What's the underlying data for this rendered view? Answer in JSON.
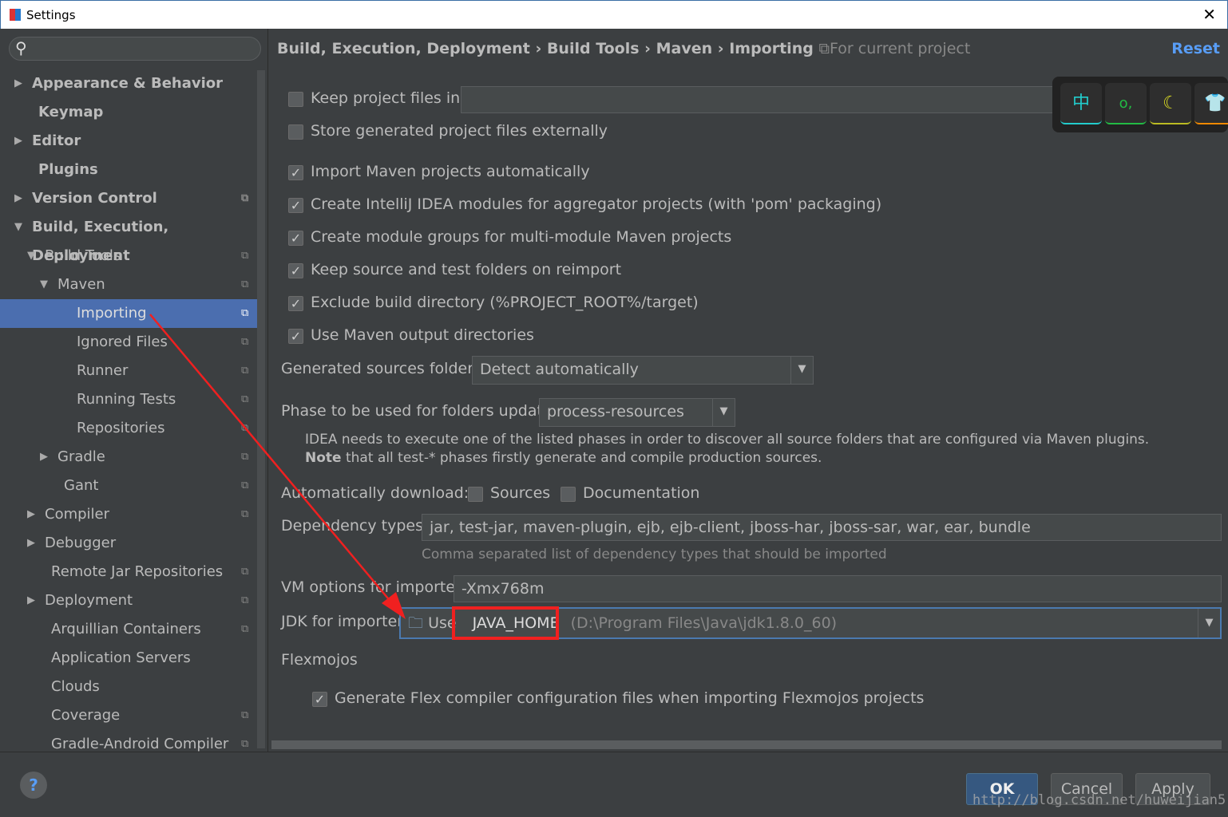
{
  "window": {
    "title": "Settings"
  },
  "sidebar": {
    "items": [
      {
        "label": "Appearance & Behavior",
        "level": 0,
        "arrow": "right",
        "bold": true,
        "proj": false
      },
      {
        "label": "Keymap",
        "level": 0,
        "arrow": "",
        "bold": true,
        "proj": false
      },
      {
        "label": "Editor",
        "level": 0,
        "arrow": "right",
        "bold": true,
        "proj": false
      },
      {
        "label": "Plugins",
        "level": 0,
        "arrow": "",
        "bold": true,
        "proj": false
      },
      {
        "label": "Version Control",
        "level": 0,
        "arrow": "right",
        "bold": true,
        "proj": true
      },
      {
        "label": "Build, Execution, Deployment",
        "level": 0,
        "arrow": "down",
        "bold": true,
        "proj": false
      },
      {
        "label": "Build Tools",
        "level": 1,
        "arrow": "down",
        "proj": true
      },
      {
        "label": "Maven",
        "level": 2,
        "arrow": "down",
        "proj": true
      },
      {
        "label": "Importing",
        "level": 3,
        "arrow": "",
        "proj": true,
        "selected": true
      },
      {
        "label": "Ignored Files",
        "level": 3,
        "arrow": "",
        "proj": true
      },
      {
        "label": "Runner",
        "level": 3,
        "arrow": "",
        "proj": true
      },
      {
        "label": "Running Tests",
        "level": 3,
        "arrow": "",
        "proj": true
      },
      {
        "label": "Repositories",
        "level": 3,
        "arrow": "",
        "proj": true
      },
      {
        "label": "Gradle",
        "level": 2,
        "arrow": "right",
        "proj": true
      },
      {
        "label": "Gant",
        "level": 2.5,
        "arrow": "",
        "proj": true
      },
      {
        "label": "Compiler",
        "level": 1,
        "arrow": "right",
        "proj": true
      },
      {
        "label": "Debugger",
        "level": 1,
        "arrow": "right",
        "proj": false
      },
      {
        "label": "Remote Jar Repositories",
        "level": 1.5,
        "arrow": "",
        "proj": true
      },
      {
        "label": "Deployment",
        "level": 1,
        "arrow": "right",
        "proj": true
      },
      {
        "label": "Arquillian Containers",
        "level": 1.5,
        "arrow": "",
        "proj": true
      },
      {
        "label": "Application Servers",
        "level": 1.5,
        "arrow": "",
        "proj": false
      },
      {
        "label": "Clouds",
        "level": 1.5,
        "arrow": "",
        "proj": false
      },
      {
        "label": "Coverage",
        "level": 1.5,
        "arrow": "",
        "proj": true
      },
      {
        "label": "Gradle-Android Compiler",
        "level": 1.5,
        "arrow": "",
        "proj": true
      }
    ]
  },
  "header": {
    "breadcrumb": "Build, Execution, Deployment › Build Tools › Maven › Importing",
    "for_project": "For current project",
    "reset": "Reset"
  },
  "options": {
    "keep_files": {
      "label": "Keep project files in:",
      "checked": false,
      "value": ""
    },
    "store_external": {
      "label": "Store generated project files externally",
      "checked": false
    },
    "checks": [
      {
        "label": "Import Maven projects automatically",
        "checked": true
      },
      {
        "label": "Create IntelliJ IDEA modules for aggregator projects (with 'pom' packaging)",
        "checked": true
      },
      {
        "label": "Create module groups for multi-module Maven projects",
        "checked": true
      },
      {
        "label": "Keep source and test folders on reimport",
        "checked": true
      },
      {
        "label": "Exclude build directory (%PROJECT_ROOT%/target)",
        "checked": true
      },
      {
        "label": "Use Maven output directories",
        "checked": true
      }
    ],
    "gen_sources": {
      "label": "Generated sources folders:",
      "value": "Detect automatically"
    },
    "phase": {
      "label": "Phase to be used for folders update:",
      "value": "process-resources"
    },
    "phase_note1": "IDEA needs to execute one of the listed phases in order to discover all source folders that are configured via Maven plugins.",
    "phase_note2_bold": "Note",
    "phase_note2": " that all test-* phases firstly generate and compile production sources.",
    "auto_download": {
      "label": "Automatically download:",
      "sources": "Sources",
      "documentation": "Documentation"
    },
    "dep_types": {
      "label": "Dependency types:",
      "value": "jar, test-jar, maven-plugin, ejb, ejb-client, jboss-har, jboss-sar, war, ear, bundle",
      "hint": "Comma separated list of dependency types that should be imported"
    },
    "vm_options": {
      "label": "VM options for importer:",
      "value": "-Xmx768m"
    },
    "jdk": {
      "label": "JDK for importer:",
      "prefix": "Use",
      "value": "JAVA_HOME",
      "path": "(D:\\Program Files\\Java\\jdk1.8.0_60)"
    },
    "flexmojos": {
      "title": "Flexmojos",
      "label": "Generate Flex compiler configuration files when importing Flexmojos projects",
      "checked": true
    }
  },
  "ime": {
    "keys": [
      "中",
      "o,",
      "☾",
      "👕"
    ]
  },
  "footer": {
    "ok": "OK",
    "cancel": "Cancel",
    "apply": "Apply",
    "help": "?",
    "watermark": "http://blog.csdn.net/huweijian5"
  },
  "colors": {
    "accent": "#4b6eaf",
    "link": "#589df6",
    "annotation": "#f02020"
  }
}
